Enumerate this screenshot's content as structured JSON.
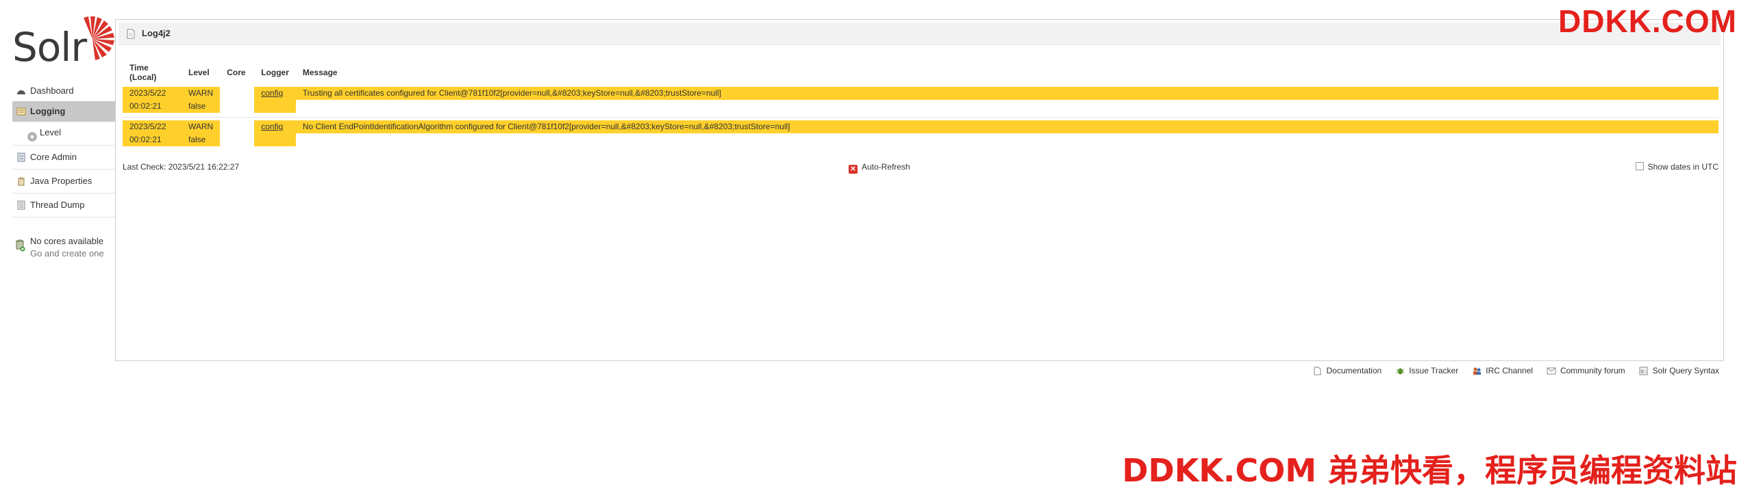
{
  "brand": {
    "logo_text": "Solr"
  },
  "watermark": {
    "top": "DDKK.COM",
    "bottom": "DDKK.COM 弟弟快看，程序员编程资料站"
  },
  "sidebar": {
    "items": [
      {
        "label": "Dashboard",
        "icon": "dashboard-icon"
      },
      {
        "label": "Logging",
        "icon": "logging-icon",
        "active": true
      },
      {
        "label": "Level",
        "icon": "level-icon",
        "sub": true
      },
      {
        "label": "Core Admin",
        "icon": "core-admin-icon"
      },
      {
        "label": "Java Properties",
        "icon": "java-properties-icon"
      },
      {
        "label": "Thread Dump",
        "icon": "thread-dump-icon"
      }
    ],
    "no_cores": {
      "title": "No cores available",
      "sub": "Go and create one"
    }
  },
  "panel": {
    "title": "Log4j2"
  },
  "table": {
    "headers": {
      "time": "Time (Local)",
      "level": "Level",
      "core": "Core",
      "logger": "Logger",
      "message": "Message"
    },
    "rows": [
      {
        "date": "2023/5/22",
        "time": "00:02:21",
        "level": "WARN",
        "flag": "false",
        "core": "",
        "logger": "config",
        "message": "Trusting all certificates configured for Client@781f10f2[provider=null,&#8203;keyStore=null,&#8203;trustStore=null]"
      },
      {
        "date": "2023/5/22",
        "time": "00:02:21",
        "level": "WARN",
        "flag": "false",
        "core": "",
        "logger": "config",
        "message": "No Client EndPointIdentificationAlgorithm configured for Client@781f10f2[provider=null,&#8203;keyStore=null,&#8203;trustStore=null]"
      }
    ]
  },
  "status": {
    "last_check": "Last Check: 2023/5/21 16:22:27",
    "auto_refresh": "Auto-Refresh",
    "show_utc": "Show dates in UTC"
  },
  "footer": [
    {
      "label": "Documentation",
      "icon": "document-icon"
    },
    {
      "label": "Issue Tracker",
      "icon": "bug-icon"
    },
    {
      "label": "IRC Channel",
      "icon": "irc-icon"
    },
    {
      "label": "Community forum",
      "icon": "mail-icon"
    },
    {
      "label": "Solr Query Syntax",
      "icon": "query-syntax-icon"
    }
  ],
  "colors": {
    "warn": "#ffd02b",
    "active_nav": "#c8c8c8",
    "watermark": "#e4211c",
    "logo_sun": "#d9342b"
  }
}
